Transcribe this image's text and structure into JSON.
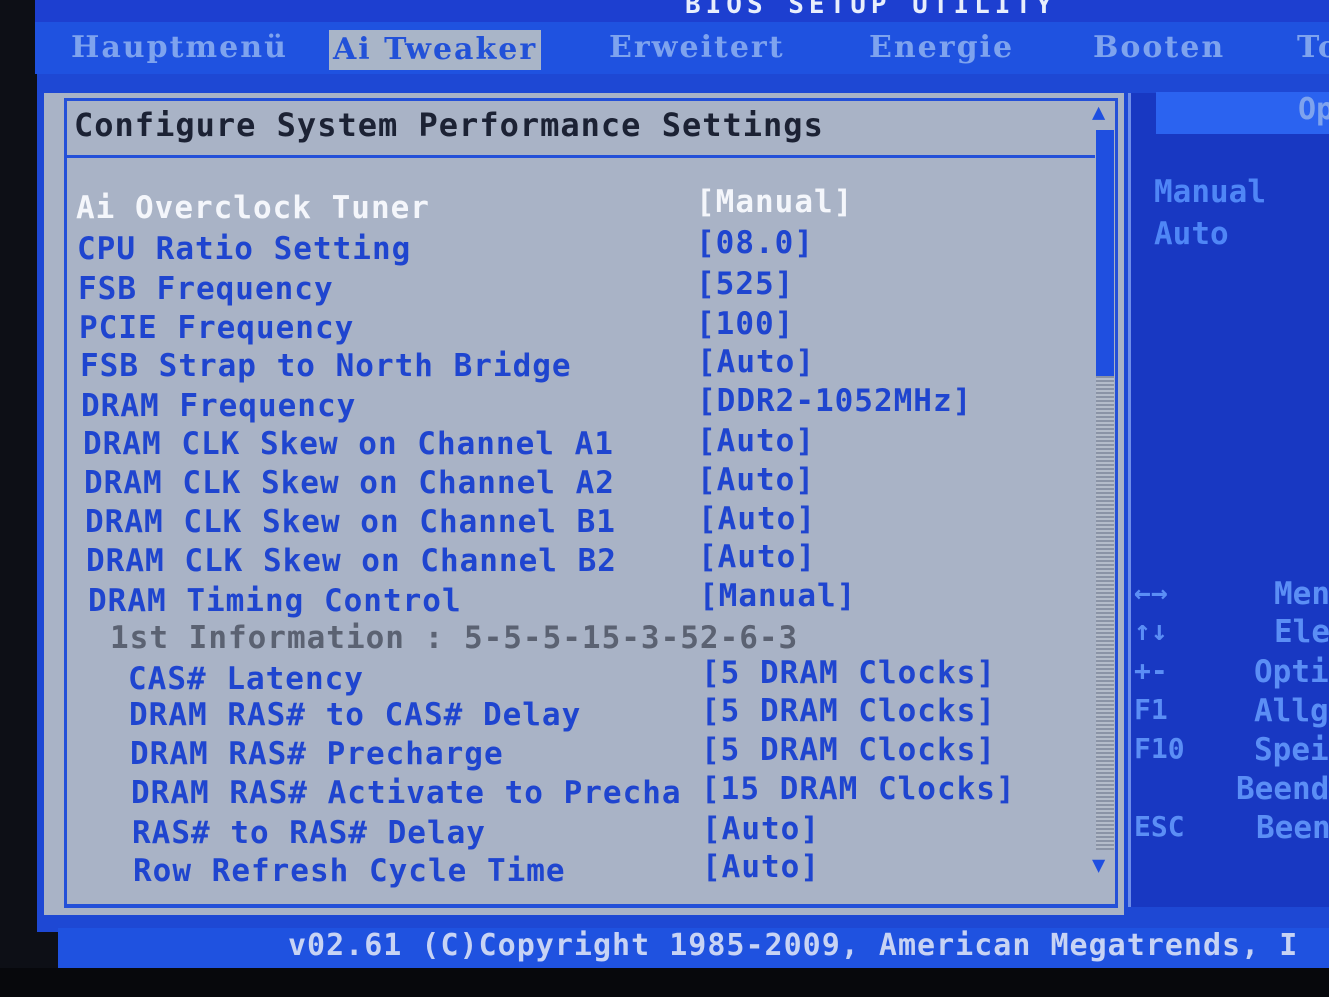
{
  "app": {
    "title": "BIOS SETUP UTILITY"
  },
  "tabs": [
    {
      "label": "Hauptmenü",
      "active": false
    },
    {
      "label": "Ai Tweaker",
      "active": true
    },
    {
      "label": "Erweitert",
      "active": false
    },
    {
      "label": "Energie",
      "active": false
    },
    {
      "label": "Booten",
      "active": false
    },
    {
      "label": "To",
      "active": false
    }
  ],
  "panel": {
    "title": "Configure System Performance Settings"
  },
  "settings": [
    {
      "label": "Ai Overclock Tuner",
      "value": "[Manual]",
      "selected": true
    },
    {
      "label": "CPU Ratio Setting",
      "value": "[08.0]"
    },
    {
      "label": "FSB Frequency",
      "value": "[525]"
    },
    {
      "label": "PCIE Frequency",
      "value": "[100]"
    },
    {
      "label": "FSB Strap to North Bridge",
      "value": "[Auto]"
    },
    {
      "label": "DRAM Frequency",
      "value": "[DDR2-1052MHz]"
    },
    {
      "label": "DRAM CLK Skew on Channel A1",
      "value": "[Auto]"
    },
    {
      "label": "DRAM CLK Skew on Channel A2",
      "value": "[Auto]"
    },
    {
      "label": "DRAM CLK Skew on Channel B1",
      "value": "[Auto]"
    },
    {
      "label": "DRAM CLK Skew on Channel B2",
      "value": "[Auto]"
    },
    {
      "label": "DRAM Timing Control",
      "value": "[Manual]"
    },
    {
      "label": "1st Information : 5-5-5-15-3-52-6-3",
      "value": "",
      "info": true
    },
    {
      "label": "CAS# Latency",
      "value": "[5 DRAM Clocks]"
    },
    {
      "label": "DRAM RAS# to CAS# Delay",
      "value": "[5 DRAM Clocks]"
    },
    {
      "label": "DRAM RAS# Precharge",
      "value": "[5 DRAM Clocks]"
    },
    {
      "label": "DRAM RAS# Activate to Precha",
      "value": "[15 DRAM Clocks]"
    },
    {
      "label": "RAS# to RAS# Delay",
      "value": "[Auto]"
    },
    {
      "label": "Row Refresh Cycle Time",
      "value": "[Auto]"
    }
  ],
  "help": {
    "options_header": "Op",
    "options": [
      "Manual",
      "Auto"
    ],
    "keys": [
      {
        "key": "←→",
        "desc": "Men"
      },
      {
        "key": "↑↓",
        "desc": "Ele"
      },
      {
        "key": "+-",
        "desc": "Opti"
      },
      {
        "key": "F1",
        "desc": "Allg"
      },
      {
        "key": "F10",
        "desc": "Spei"
      },
      {
        "key": "",
        "desc": "Beend"
      },
      {
        "key": "ESC",
        "desc": "Been"
      }
    ]
  },
  "scrollbar": {
    "up_arrow": "▲",
    "down_arrow": "▼"
  },
  "footer": {
    "text": "v02.61 (C)Copyright 1985-2009, American Megatrends, I"
  },
  "colors": {
    "frame_blue": "#1e48d4",
    "panel_gray": "#a9b3c6",
    "item_blue": "#1f45cf",
    "selected_white": "#f4f6fb"
  }
}
